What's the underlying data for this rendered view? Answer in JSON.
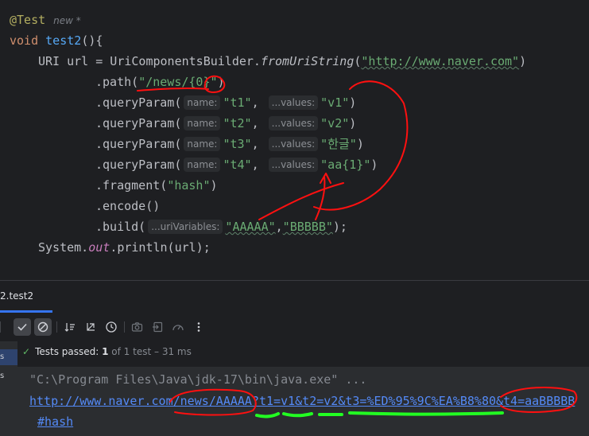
{
  "editor": {
    "annotation": "@Test",
    "annotation_meta": "new *",
    "kw_void": "void",
    "method_name": "test2",
    "method_tail": "(){",
    "uri_decl": "URI url = UriComponentsBuilder.",
    "from_uri": "fromUriString",
    "open_paren": "(",
    "url_literal": "\"http://www.naver.com\"",
    "close_paren": ")",
    "path_call": ".path(",
    "path_literal": "\"/news/{0}\"",
    "path_close": ")",
    "query_call": ".queryParam(",
    "hint_name": "name:",
    "hint_values": "...values:",
    "comma": ", ",
    "query_close": ")",
    "query_params": [
      {
        "name": "\"t1\"",
        "value": "\"v1\""
      },
      {
        "name": "\"t2\"",
        "value": "\"v2\""
      },
      {
        "name": "\"t3\"",
        "value": "\"한글\""
      },
      {
        "name": "\"t4\"",
        "value": "\"aa{1}\""
      }
    ],
    "fragment_call": ".fragment(",
    "fragment_literal": "\"hash\"",
    "fragment_close": ")",
    "encode_call": ".encode()",
    "build_call": ".build(",
    "hint_uri_vars": "...uriVariables:",
    "build_arg1": "\"AAAAA\"",
    "build_comma": ",",
    "build_arg2": "\"BBBBB\"",
    "build_close": ");",
    "println_prefix": "System.",
    "println_out": "out",
    "println_suffix": ".println(url);"
  },
  "tool_window": {
    "tab_label": "2.test2",
    "toolbar_icons": [
      "check-icon",
      "stop-circle-icon",
      "sort-icon",
      "collapse-icon",
      "history-icon",
      "camera-icon",
      "import-icon",
      "gauge-icon",
      "more-icon"
    ],
    "tree_items": [
      "s",
      "s"
    ],
    "status": {
      "label": "Tests passed:",
      "passed": "1",
      "of_label": "of 1 test",
      "time": "– 31 ms"
    },
    "console": {
      "line1": "\"C:\\Program Files\\Java\\jdk-17\\bin\\java.exe\" ...",
      "line2": "http://www.naver.com/news/AAAAA?t1=v1&t2=v2&t3=%ED%95%9C%EA%B8%80&t4=aaBBBBB",
      "line3": "#hash"
    }
  },
  "colors": {
    "background": "#1e1f22",
    "keyword": "#cf8e6d",
    "string": "#6aab73",
    "method": "#56a8f5",
    "link": "#548af7",
    "annotation_red": "#ff0000",
    "annotation_green": "#22ff22"
  }
}
